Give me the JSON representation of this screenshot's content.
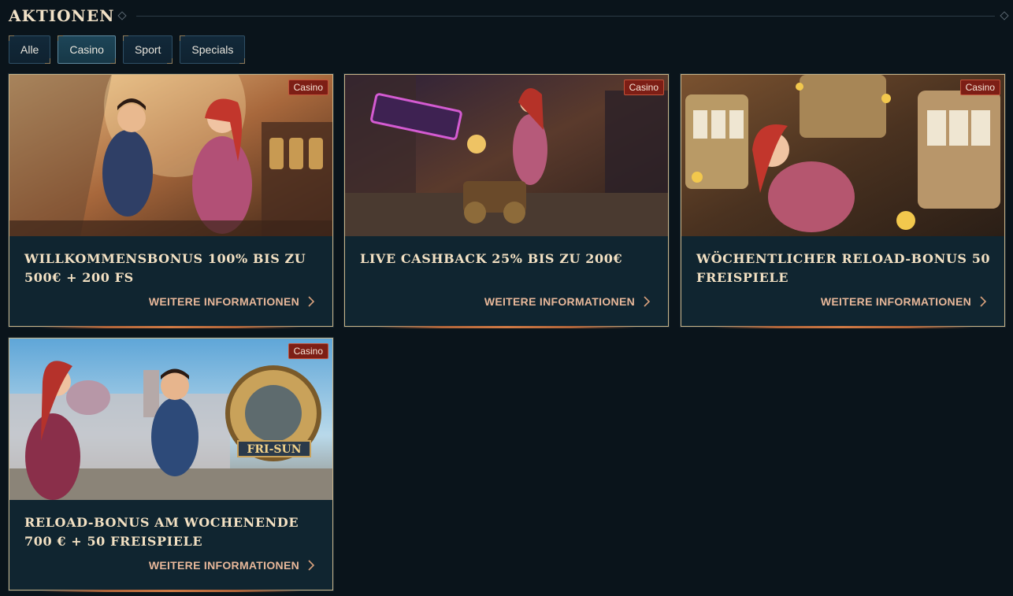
{
  "header": {
    "title": "AKTIONEN"
  },
  "filters": [
    {
      "label": "Alle"
    },
    {
      "label": "Casino"
    },
    {
      "label": "Sport"
    },
    {
      "label": "Specials"
    }
  ],
  "active_filter": "Casino",
  "cards": [
    {
      "badge": "Casino",
      "title": "WILLKOMMENSBONUS 100% BIS ZU 500€ + 200 FS",
      "link": "WEITERE INFORMATIONEN"
    },
    {
      "badge": "Casino",
      "title": "LIVE CASHBACK 25% BIS ZU 200€",
      "link": "WEITERE INFORMATIONEN"
    },
    {
      "badge": "Casino",
      "title": "WÖCHENTLICHER RELOAD-BONUS 50 FREISPIELE",
      "link": "WEITERE INFORMATIONEN"
    },
    {
      "badge": "Casino",
      "title": "RELOAD-BONUS AM WOCHENENDE 700 € + 50 FREISPIELE",
      "link": "WEITERE INFORMATIONEN",
      "image_sign": "FRI-SUN"
    }
  ],
  "colors": {
    "background": "#0a141b",
    "card": "#102530",
    "badge": "#7d1e15",
    "link": "#e8b89a",
    "gold": "#c8b489"
  }
}
